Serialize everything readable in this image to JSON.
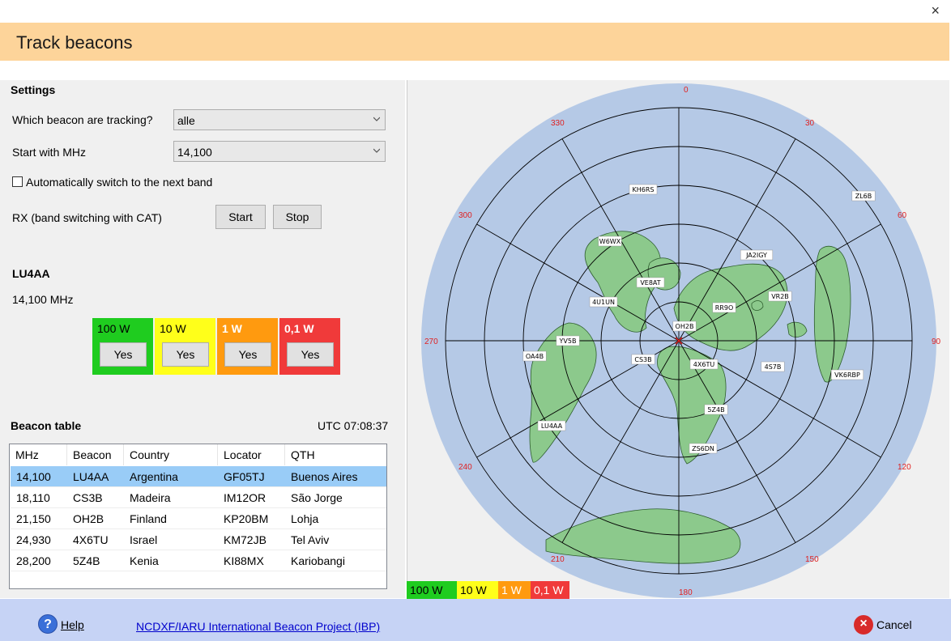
{
  "window": {
    "title": "Track beacons",
    "close_glyph": "×"
  },
  "settings": {
    "heading": "Settings",
    "which_label": "Which beacon are tracking?",
    "which_value": "alle",
    "start_label": "Start with MHz",
    "start_value": "14,100",
    "auto_switch_label": "Automatically switch to the next band",
    "auto_switch_checked": false,
    "rx_label": "RX (band switching with CAT)",
    "start_button": "Start",
    "stop_button": "Stop"
  },
  "current": {
    "callsign": "LU4AA",
    "frequency": "14,100 MHz",
    "power_levels": [
      {
        "label": "100 W",
        "button": "Yes",
        "color": "#1fcc1f"
      },
      {
        "label": "10 W",
        "button": "Yes",
        "color": "#ffff1a"
      },
      {
        "label": "1 W",
        "button": "Yes",
        "color": "#ff9a0f"
      },
      {
        "label": "0,1 W",
        "button": "Yes",
        "color": "#f03a3a"
      }
    ]
  },
  "beacon_table": {
    "title": "Beacon table",
    "utc": "UTC 07:08:37",
    "columns": [
      "MHz",
      "Beacon",
      "Country",
      "Locator",
      "QTH"
    ],
    "rows": [
      [
        "14,100",
        "LU4AA",
        "Argentina",
        "GF05TJ",
        "Buenos Aires"
      ],
      [
        "18,110",
        "CS3B",
        "Madeira",
        "IM12OR",
        "São Jorge"
      ],
      [
        "21,150",
        "OH2B",
        "Finland",
        "KP20BM",
        "Lohja"
      ],
      [
        "24,930",
        "4X6TU",
        "Israel",
        "KM72JB",
        "Tel Aviv"
      ],
      [
        "28,200",
        "5Z4B",
        "Kenia",
        "KI88MX",
        "Kariobangi"
      ]
    ],
    "selected_row": 0
  },
  "map": {
    "bearing_labels": [
      "0",
      "30",
      "60",
      "90",
      "120",
      "150",
      "180",
      "210",
      "240",
      "270",
      "300",
      "330"
    ],
    "beacons": [
      "KH6RS",
      "ZL6B",
      "W6WX",
      "JA2IGY",
      "VE8AT",
      "4U1UN",
      "VR2B",
      "RR9O",
      "OH2B",
      "YV5B",
      "OA4B",
      "CS3B",
      "4X6TU",
      "4S7B",
      "VK6RBP",
      "5Z4B",
      "LU4AA",
      "ZS6DN"
    ],
    "legend": [
      {
        "label": "100 W",
        "color": "#1fcc1f"
      },
      {
        "label": "10 W",
        "color": "#ffff1a"
      },
      {
        "label": "1 W",
        "color": "#ff9a0f"
      },
      {
        "label": "0,1 W",
        "color": "#f03a3a"
      }
    ],
    "ocean_color": "#b5c9e6",
    "land_color": "#8cc98c"
  },
  "footer": {
    "help_label": "Help",
    "project_link": "NCDXF/IARU International Beacon Project  (IBP)",
    "cancel_label": "Cancel"
  }
}
